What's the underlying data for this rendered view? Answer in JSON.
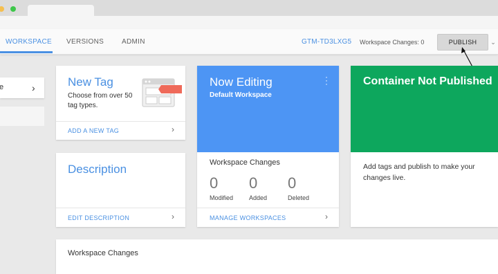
{
  "nav": {
    "tabs": [
      {
        "label": "WORKSPACE"
      },
      {
        "label": "VERSIONS"
      },
      {
        "label": "ADMIN"
      }
    ],
    "container_id": "GTM-TD3LXG5",
    "workspace_changes": "Workspace Changes: 0",
    "publish_label": "PUBLISH"
  },
  "sidebar": {
    "item_fragment": "e"
  },
  "new_tag": {
    "title": "New Tag",
    "description": "Choose from over 50 tag types.",
    "link": "ADD A NEW TAG"
  },
  "description_card": {
    "title": "Description",
    "link": "EDIT DESCRIPTION"
  },
  "now_editing": {
    "title": "Now Editing",
    "subtitle": "Default Workspace",
    "changes_title": "Workspace Changes",
    "stats": [
      {
        "value": "0",
        "label": "Modified"
      },
      {
        "value": "0",
        "label": "Added"
      },
      {
        "value": "0",
        "label": "Deleted"
      }
    ],
    "link": "MANAGE WORKSPACES"
  },
  "not_published": {
    "title": "Container Not Published",
    "body": "Add tags and publish to make your changes live."
  },
  "bottom": {
    "title": "Workspace Changes"
  },
  "colors": {
    "accent_blue": "#4a90e2",
    "card_blue": "#4d95f4",
    "card_green": "#0da75d",
    "tag_red": "#ef6a5a"
  }
}
